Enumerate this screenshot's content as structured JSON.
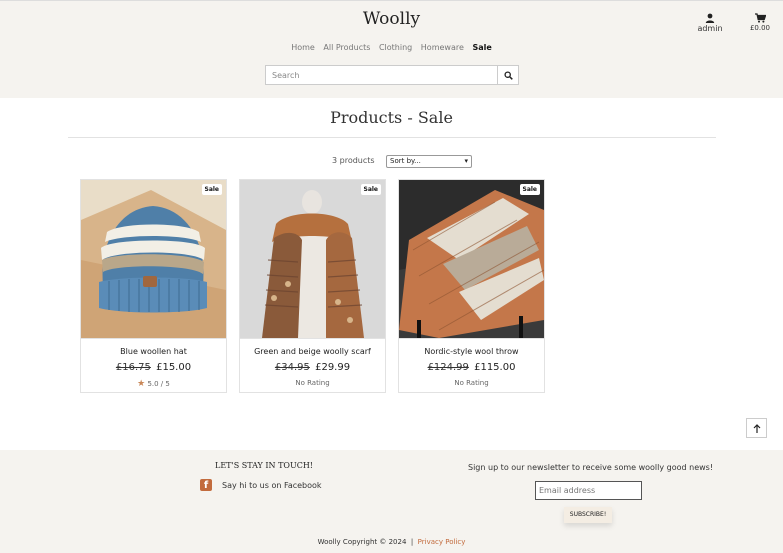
{
  "header": {
    "brand": "Woolly",
    "nav": [
      {
        "label": "Home",
        "active": false
      },
      {
        "label": "All Products",
        "active": false
      },
      {
        "label": "Clothing",
        "active": false
      },
      {
        "label": "Homeware",
        "active": false
      },
      {
        "label": "Sale",
        "active": true
      }
    ],
    "account_label": "admin",
    "cart_total": "£0.00",
    "search_placeholder": "Search",
    "icons": {
      "account": "user-icon",
      "cart": "shopping-cart-icon",
      "search": "search-icon"
    }
  },
  "main": {
    "title": "Products - Sale",
    "product_count": "3 products",
    "sort_selected": "Sort by...",
    "products": [
      {
        "badge": "Sale",
        "name": "Blue woollen hat",
        "old_price": "£16.75",
        "price": "£15.00",
        "rating": "5.0 / 5",
        "has_star": true
      },
      {
        "badge": "Sale",
        "name": "Green and beige woolly scarf",
        "old_price": "£34.95",
        "price": "£29.99",
        "rating": "No Rating",
        "has_star": false
      },
      {
        "badge": "Sale",
        "name": "Nordic-style wool throw",
        "old_price": "£124.99",
        "price": "£115.00",
        "rating": "No Rating",
        "has_star": false
      }
    ]
  },
  "footer": {
    "touch_title": "LET'S STAY IN TOUCH!",
    "facebook_text": "Say hi to us on Facebook",
    "newsletter_text": "Sign up to our newsletter to receive some woolly good news!",
    "email_placeholder": "Email address",
    "subscribe_label": "SUBSCRIBE!",
    "copyright": "Woolly Copyright © 2024",
    "separator": "|",
    "privacy": "Privacy Policy"
  },
  "colors": {
    "accent": "#c26b3d",
    "header_bg": "#f5f3ef",
    "star": "#c98757"
  }
}
